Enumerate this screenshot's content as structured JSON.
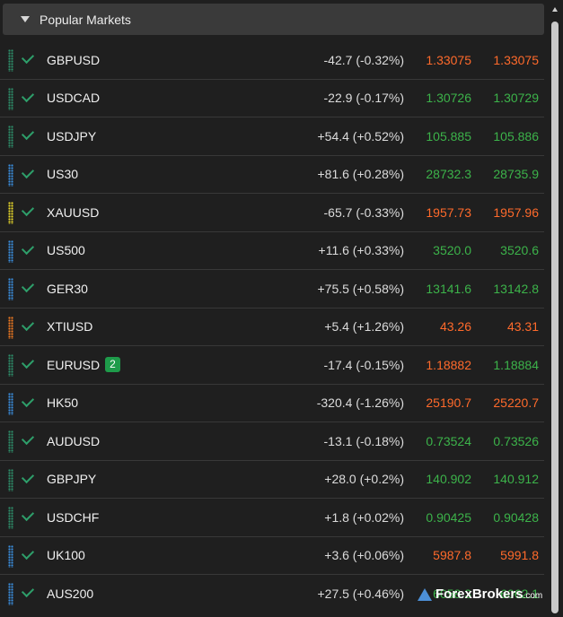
{
  "colors": {
    "up": "#3cb34a",
    "down": "#ff6a2b"
  },
  "header": {
    "title": "Popular Markets",
    "caret_icon": "caret-down-icon"
  },
  "markets": [
    {
      "symbol": "GBPUSD",
      "change": "-42.7 (-0.32%)",
      "bid": "1.33075",
      "ask": "1.33075",
      "bid_dir": "down",
      "ask_dir": "down",
      "grip": "#2e8f6a"
    },
    {
      "symbol": "USDCAD",
      "change": "-22.9 (-0.17%)",
      "bid": "1.30726",
      "ask": "1.30729",
      "bid_dir": "up",
      "ask_dir": "up",
      "grip": "#2e8f6a"
    },
    {
      "symbol": "USDJPY",
      "change": "+54.4 (+0.52%)",
      "bid": "105.885",
      "ask": "105.886",
      "bid_dir": "up",
      "ask_dir": "up",
      "grip": "#2e8f6a"
    },
    {
      "symbol": "US30",
      "change": "+81.6 (+0.28%)",
      "bid": "28732.3",
      "ask": "28735.9",
      "bid_dir": "up",
      "ask_dir": "up",
      "grip": "#3a8fe0"
    },
    {
      "symbol": "XAUUSD",
      "change": "-65.7 (-0.33%)",
      "bid": "1957.73",
      "ask": "1957.96",
      "bid_dir": "down",
      "ask_dir": "down",
      "grip": "#e8d82a"
    },
    {
      "symbol": "US500",
      "change": "+11.6 (+0.33%)",
      "bid": "3520.0",
      "ask": "3520.6",
      "bid_dir": "up",
      "ask_dir": "up",
      "grip": "#3a8fe0"
    },
    {
      "symbol": "GER30",
      "change": "+75.5 (+0.58%)",
      "bid": "13141.6",
      "ask": "13142.8",
      "bid_dir": "up",
      "ask_dir": "up",
      "grip": "#3a8fe0"
    },
    {
      "symbol": "XTIUSD",
      "change": "+5.4 (+1.26%)",
      "bid": "43.26",
      "ask": "43.31",
      "bid_dir": "down",
      "ask_dir": "down",
      "grip": "#f07a22"
    },
    {
      "symbol": "EURUSD",
      "badge": "2",
      "change": "-17.4 (-0.15%)",
      "bid": "1.18882",
      "ask": "1.18884",
      "bid_dir": "down",
      "ask_dir": "up",
      "grip": "#2e8f6a"
    },
    {
      "symbol": "HK50",
      "change": "-320.4 (-1.26%)",
      "bid": "25190.7",
      "ask": "25220.7",
      "bid_dir": "down",
      "ask_dir": "down",
      "grip": "#3a8fe0"
    },
    {
      "symbol": "AUDUSD",
      "change": "-13.1 (-0.18%)",
      "bid": "0.73524",
      "ask": "0.73526",
      "bid_dir": "up",
      "ask_dir": "up",
      "grip": "#2e8f6a"
    },
    {
      "symbol": "GBPJPY",
      "change": "+28.0 (+0.2%)",
      "bid": "140.902",
      "ask": "140.912",
      "bid_dir": "up",
      "ask_dir": "up",
      "grip": "#2e8f6a"
    },
    {
      "symbol": "USDCHF",
      "change": "+1.8 (+0.02%)",
      "bid": "0.90425",
      "ask": "0.90428",
      "bid_dir": "up",
      "ask_dir": "up",
      "grip": "#2e8f6a"
    },
    {
      "symbol": "UK100",
      "change": "+3.6 (+0.06%)",
      "bid": "5987.8",
      "ask": "5991.8",
      "bid_dir": "down",
      "ask_dir": "down",
      "grip": "#3a8fe0"
    },
    {
      "symbol": "AUS200",
      "change": "+27.5 (+0.46%)",
      "bid": "6058.3",
      "ask": "6062.1",
      "bid_dir": "up",
      "ask_dir": "up",
      "grip": "#3a8fe0"
    }
  ],
  "watermark": {
    "brand": "ForexBrokers",
    "suffix": ".com"
  }
}
